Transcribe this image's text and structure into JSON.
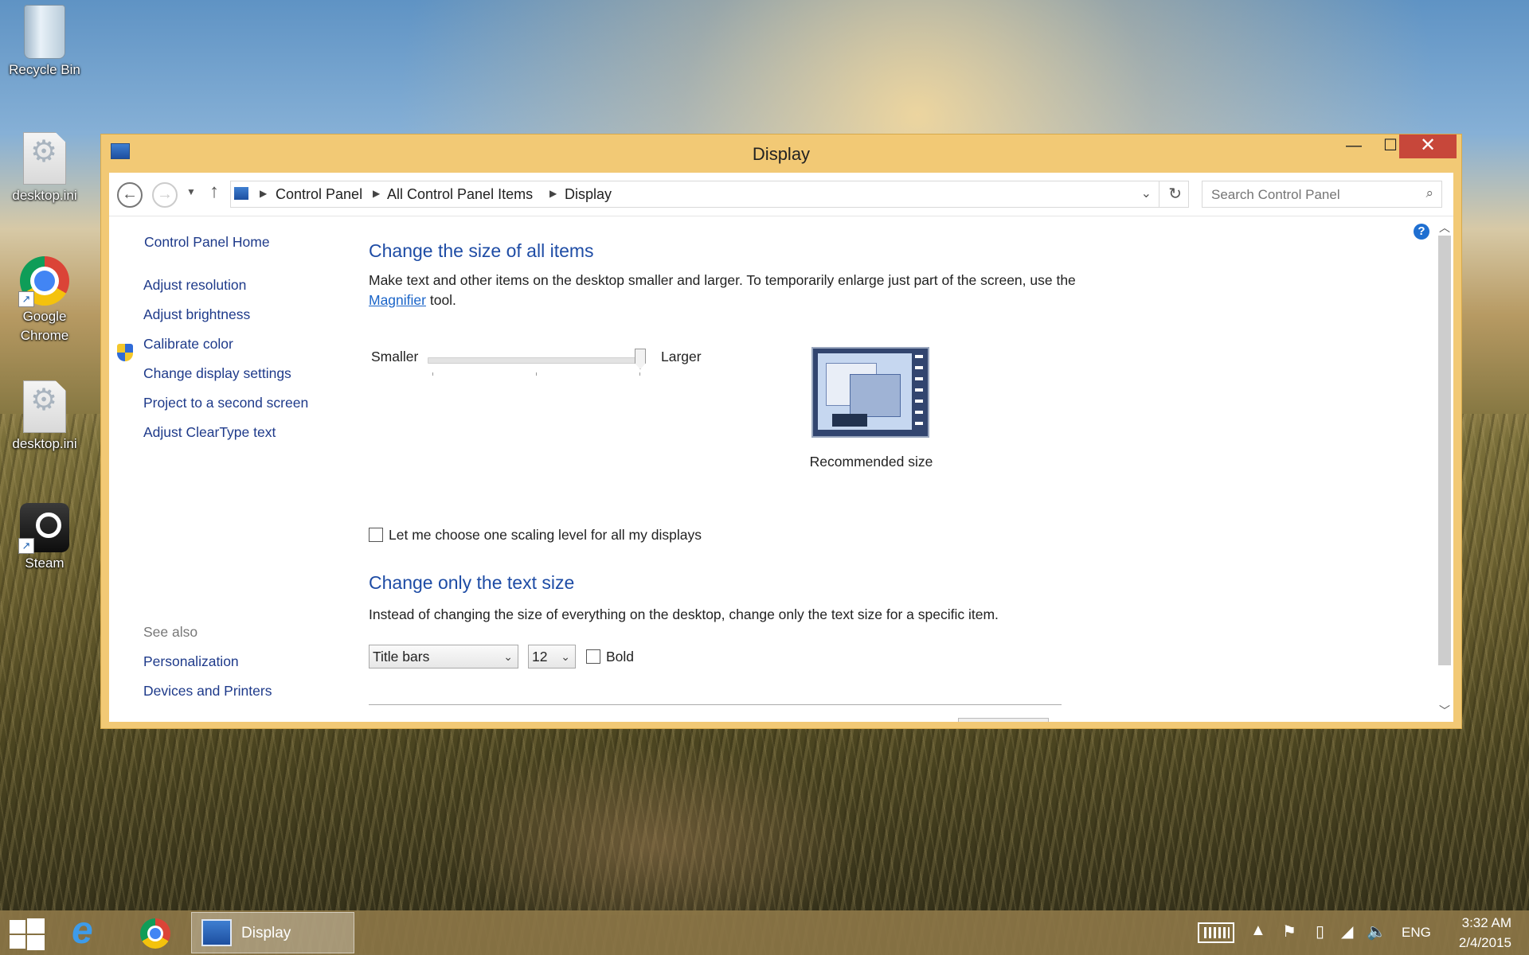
{
  "desktop": {
    "icons": [
      {
        "label": "Recycle Bin",
        "icon": "recycle-bin-icon"
      },
      {
        "label": "desktop.ini",
        "icon": "settings-file-icon"
      },
      {
        "label": "Google Chrome",
        "icon": "chrome-icon"
      },
      {
        "label": "desktop.ini",
        "icon": "settings-file-icon"
      },
      {
        "label": "Steam",
        "icon": "steam-icon"
      }
    ]
  },
  "window": {
    "title": "Display",
    "controls": {
      "minimize": "—",
      "maximize": "☐",
      "close": "✕"
    },
    "address": {
      "crumbs": [
        "Control Panel",
        "All Control Panel Items",
        "Display"
      ]
    },
    "search": {
      "placeholder": "Search Control Panel"
    },
    "sidebar": {
      "home": "Control Panel Home",
      "links": [
        "Adjust resolution",
        "Adjust brightness",
        "Calibrate color",
        "Change display settings",
        "Project to a second screen",
        "Adjust ClearType text"
      ],
      "see_also_label": "See also",
      "see_also": [
        "Personalization",
        "Devices and Printers"
      ]
    },
    "main": {
      "heading1": "Change the size of all items",
      "para1_before": "Make text and other items on the desktop smaller and larger. To temporarily enlarge just part of the screen, use the ",
      "para1_link": "Magnifier",
      "para1_after": " tool.",
      "slider": {
        "smaller": "Smaller",
        "larger": "Larger",
        "value": 1.0
      },
      "preview_label": "Recommended size",
      "scaling_checkbox": "Let me choose one scaling level for all my displays",
      "heading2": "Change only the text size",
      "para2": "Instead of changing the size of everything on the desktop, change only the text size for a specific item.",
      "item_select": "Title bars",
      "size_select": "12",
      "bold_label": "Bold"
    },
    "help": "?"
  },
  "taskbar": {
    "active_app": "Display",
    "language": "ENG",
    "time": "3:32 AM",
    "date": "2/4/2015"
  }
}
